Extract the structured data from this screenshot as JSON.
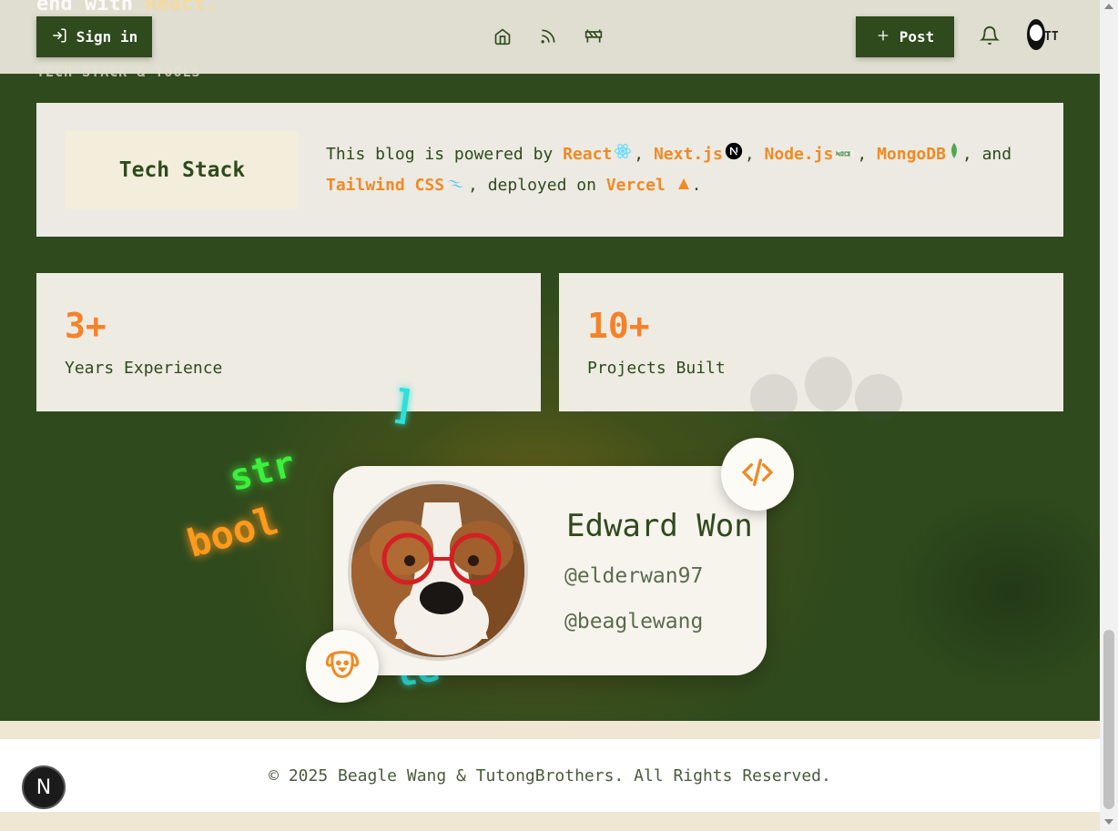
{
  "header": {
    "ghost_heading_prefix": "end with",
    "ghost_heading_highlight": "React.",
    "section_label": "TECH STACK & TOOLS",
    "signin_label": "Sign in",
    "post_label": "Post",
    "avatar_initials": "TT"
  },
  "tech_stack": {
    "title": "Tech Stack",
    "intro": "This blog is powered by",
    "items": [
      "React",
      "Next.js",
      "Node.js",
      "MongoDB",
      "Tailwind CSS",
      "Vercel"
    ],
    "sep": ",",
    "and": ", and",
    "deployed_on": ", deployed on",
    "end": "."
  },
  "stats": [
    {
      "value": "3+",
      "label": "Years Experience"
    },
    {
      "value": "10+",
      "label": "Projects Built"
    }
  ],
  "floating_words": {
    "bracket": "]",
    "str": "str",
    "bool": "bool",
    "let": "le",
    "dot": "."
  },
  "profile": {
    "name": "Edward Won",
    "handle1": "@elderwan97",
    "handle2": "@beaglewang"
  },
  "footer": {
    "copyright": "© 2025 Beagle Wang & TutongBrothers. All Rights Reserved."
  },
  "next_badge": "N",
  "colors": {
    "primary": "#2f4a1d",
    "accent": "#f08a24",
    "neon_green": "#3cf03c",
    "neon_cyan": "#2de0d8",
    "neon_orange": "#ff9a1c"
  },
  "icons": [
    "sign-in-icon",
    "home-icon",
    "rss-icon",
    "barrier-icon",
    "plus-icon",
    "bell-icon",
    "code-icon",
    "dog-icon",
    "paw-icon"
  ]
}
